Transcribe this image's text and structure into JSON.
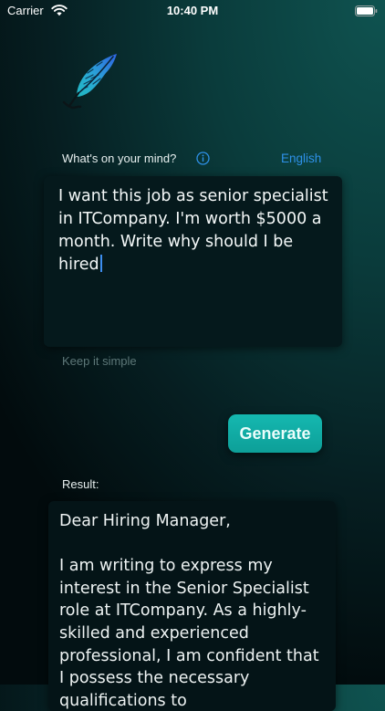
{
  "status_bar": {
    "carrier": "Carrier",
    "time": "10:40 PM",
    "wifi_icon": "wifi-icon",
    "battery_icon": "battery-icon"
  },
  "logo": {
    "icon": "feather-quill-icon",
    "colors": [
      "#1fb3c4",
      "#2a6fe0",
      "#0f1a1d"
    ]
  },
  "prompt": {
    "label": "What's on your mind?",
    "info_icon": "info-icon",
    "language": "English",
    "value": "I want this job as senior specialist in ITCompany. I'm worth $5000 a month. Write why should I be hired",
    "hint": "Keep it simple"
  },
  "generate": {
    "label": "Generate",
    "color": "#12aca5"
  },
  "result": {
    "label": "Result:",
    "greeting": "Dear Hiring Manager,",
    "body": "I am writing to express my interest in the Senior Specialist role at ITCompany. As a highly-skilled and experienced professional, I am confident that I possess the necessary qualifications to"
  },
  "colors": {
    "accent_link": "#2e91e8",
    "background_top": "#0f5350",
    "background_bottom": "#020b0d",
    "caret": "#3d8ef0"
  }
}
